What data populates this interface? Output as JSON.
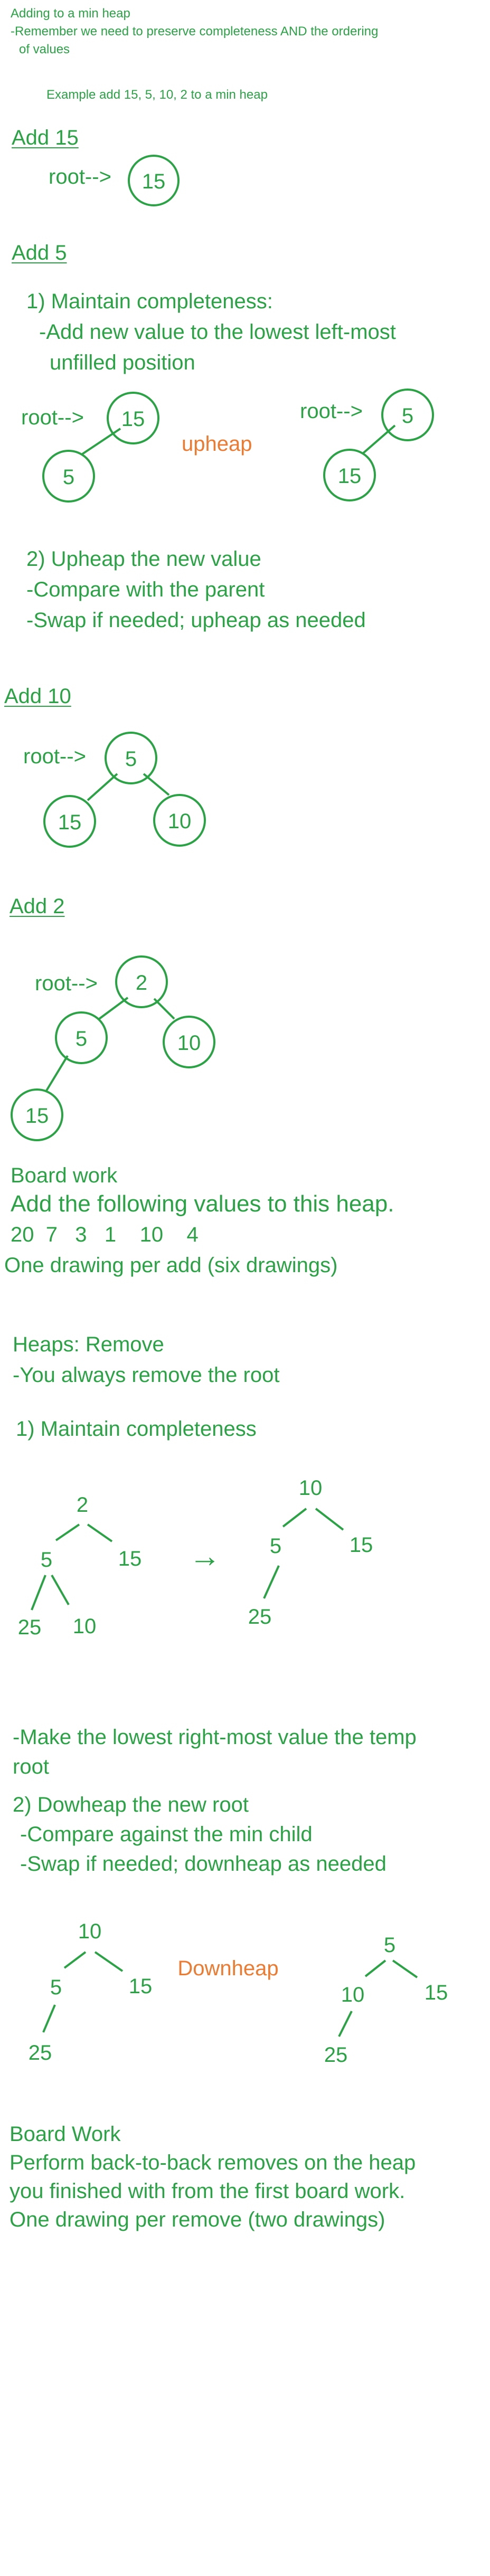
{
  "header": {
    "line1": "Adding to a min heap",
    "line2": "-Remember we need to preserve completeness AND the ordering",
    "line3": "of values",
    "example": "Example add 15, 5, 10, 2 to a min heap"
  },
  "add15": {
    "heading": "Add 15",
    "root_label": "root-->",
    "node": "15"
  },
  "add5": {
    "heading": "Add 5",
    "step1_title": "1) Maintain completeness:",
    "step1_line1": "-Add new value to the lowest left-most",
    "step1_line2": "unfilled position",
    "root_label_left": "root-->",
    "left_root": "15",
    "left_child": "5",
    "arrow_label": "upheap",
    "root_label_right": "root-->",
    "right_root": "5",
    "right_child": "15",
    "step2_title": "2) Upheap the new value",
    "step2_line1": "-Compare with the parent",
    "step2_line2": "-Swap if needed; upheap as needed"
  },
  "add10": {
    "heading": "Add 10",
    "root_label": "root-->",
    "root": "5",
    "left": "15",
    "right": "10"
  },
  "add2": {
    "heading": "Add 2",
    "root_label": "root-->",
    "root": "2",
    "left": "5",
    "right": "10",
    "left_left": "15"
  },
  "board_work_1": {
    "title": "Board work",
    "line1": "Add the following values to this heap.",
    "values": "20  7   3   1    10    4",
    "line3": "One drawing per add (six drawings)"
  },
  "remove": {
    "heading": "Heaps: Remove",
    "line1": "-You always remove the root",
    "step1": "1) Maintain completeness",
    "tree_a": {
      "root": "2",
      "left": "5",
      "right": "15",
      "ll": "25",
      "lr": "10"
    },
    "arrow": "→",
    "tree_b": {
      "root": "10",
      "left": "5",
      "right": "15",
      "ll": "25"
    },
    "note_line1": "-Make the lowest right-most value the temp",
    "note_line2": "root",
    "step2_title": "2) Dowheap the new root",
    "step2_line1": "-Compare against the min child",
    "step2_line2": "-Swap if needed; downheap as needed",
    "tree_c": {
      "root": "10",
      "left": "5",
      "right": "15",
      "ll": "25"
    },
    "downheap_label": "Downheap",
    "tree_d": {
      "root": "5",
      "left": "10",
      "right": "15",
      "ll": "25"
    }
  },
  "board_work_2": {
    "title": "Board Work",
    "line1": "Perform back-to-back removes on the heap",
    "line2": "you finished with from the first board work.",
    "line3": "One drawing per remove (two drawings)"
  },
  "colors": {
    "text_green": "#2aa345",
    "accent_orange": "#ee7a30",
    "background": "#ffffff"
  }
}
